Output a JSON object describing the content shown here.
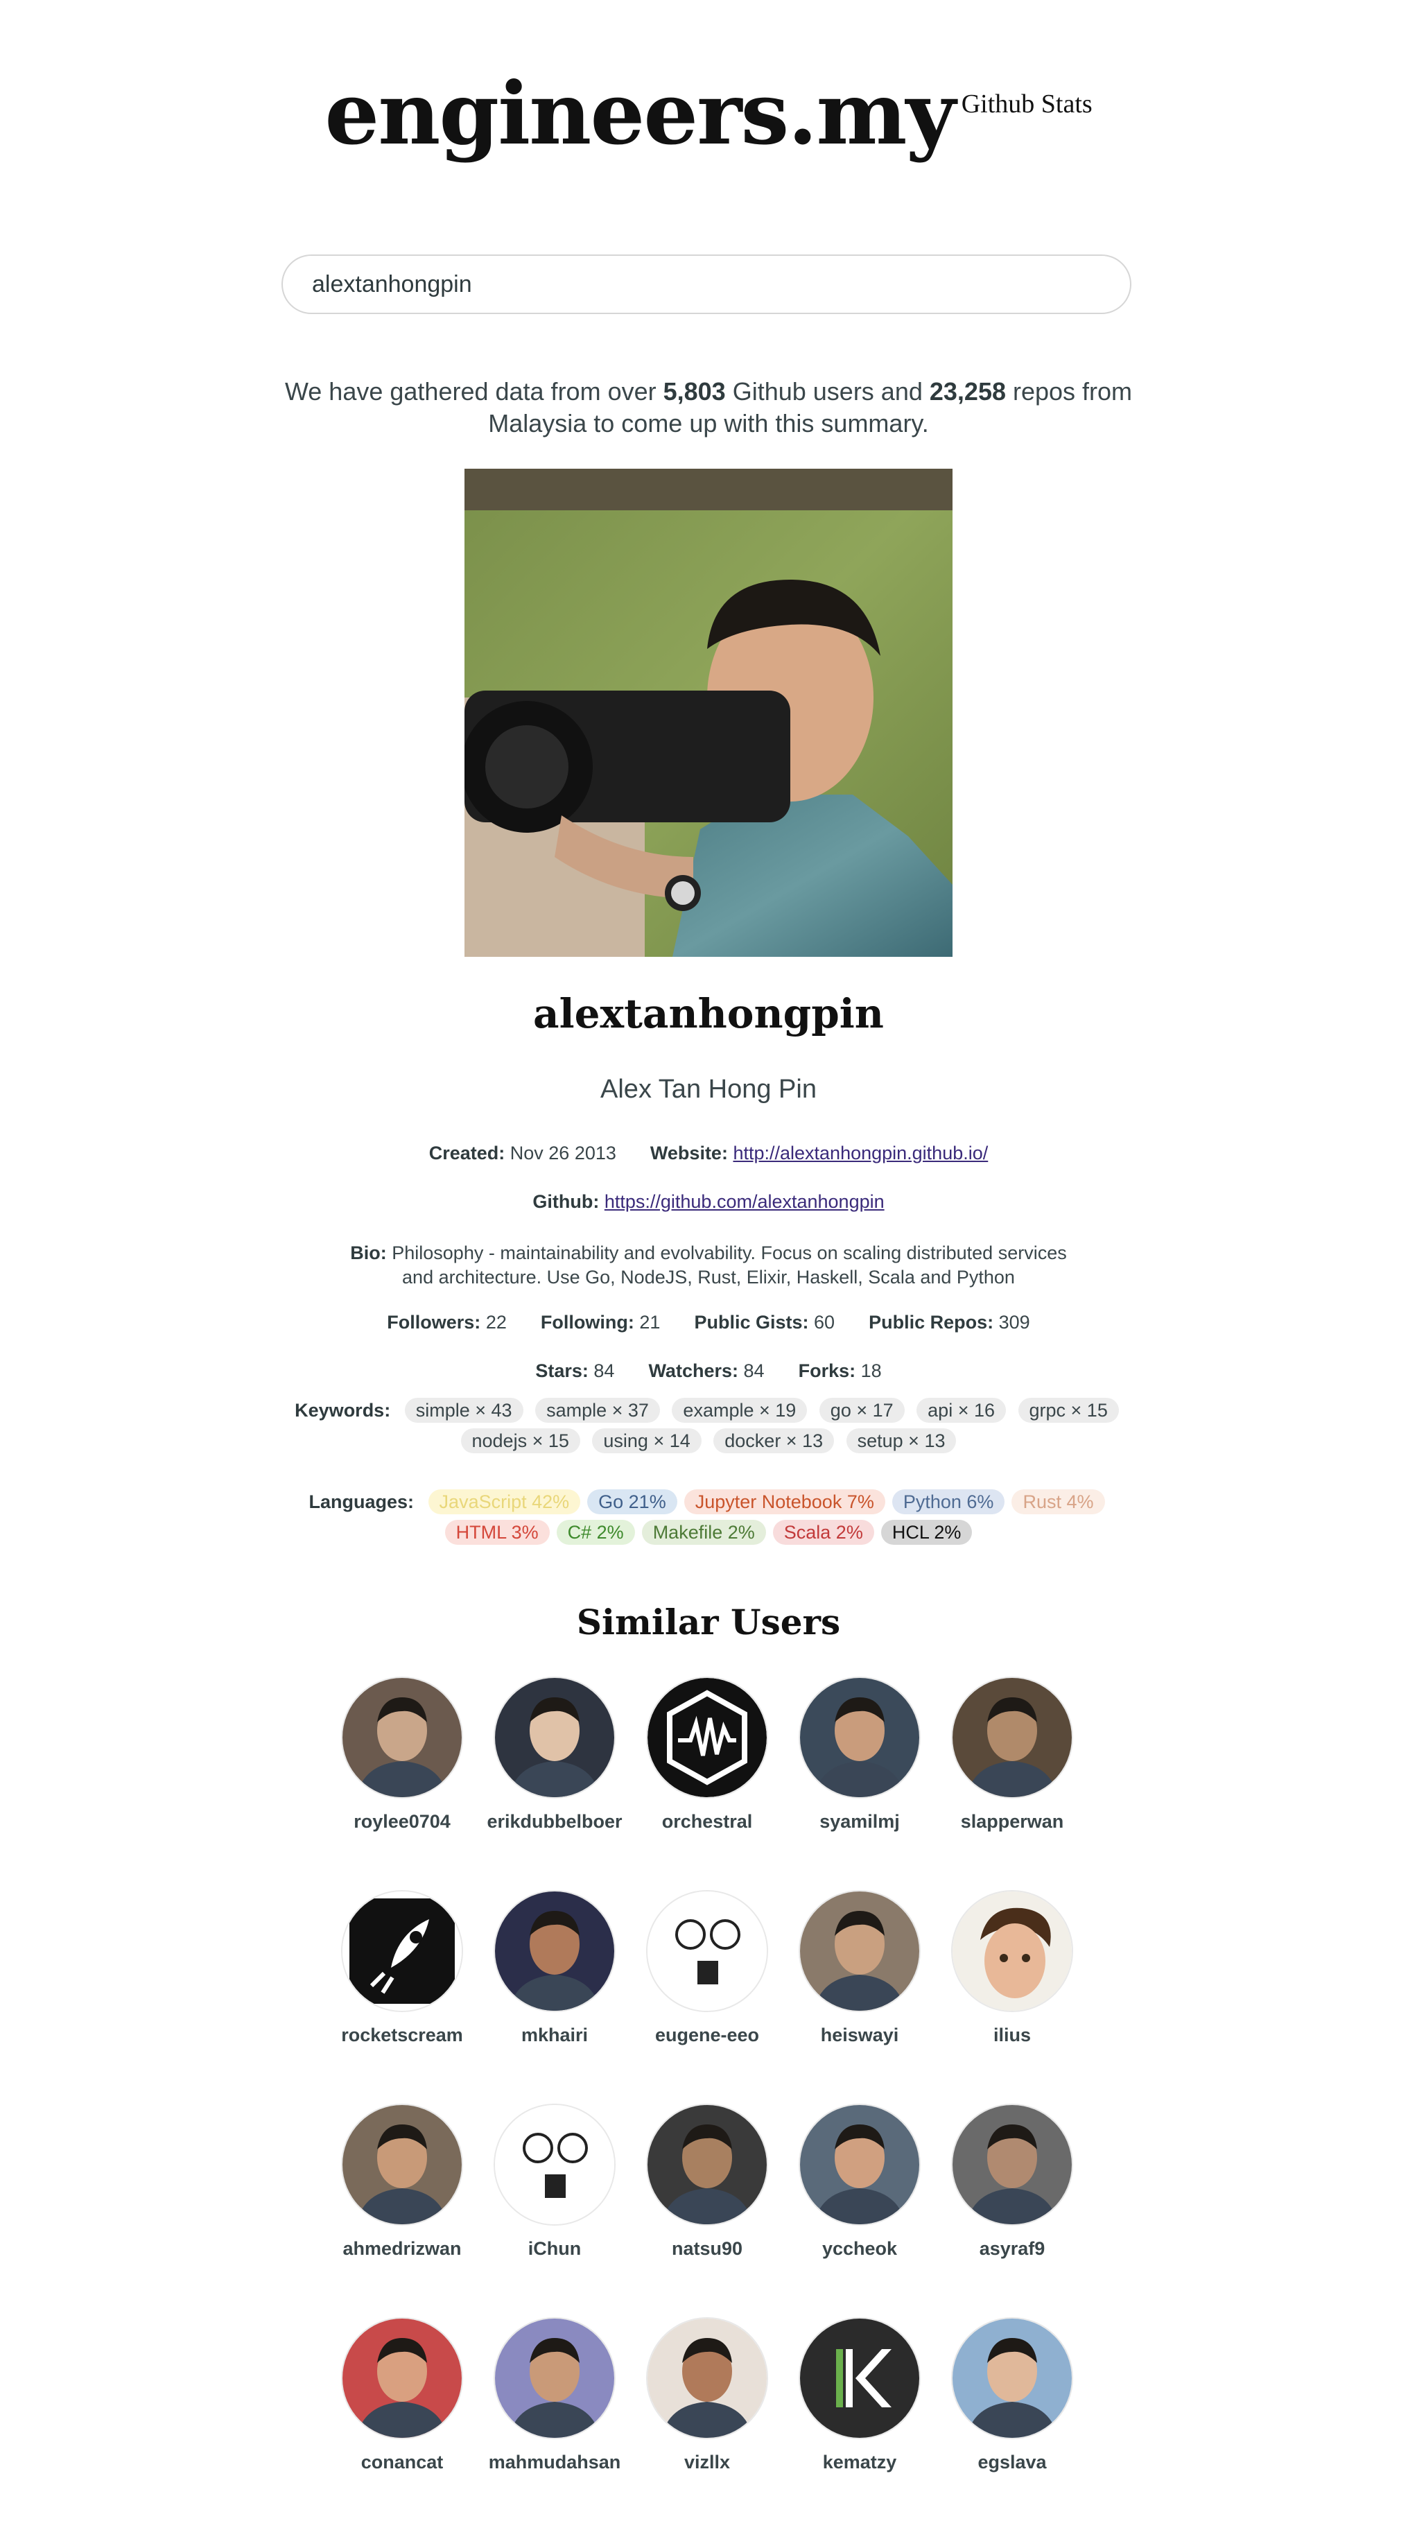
{
  "header": {
    "title": "engineers.my",
    "subtitle": "Github Stats"
  },
  "search": {
    "value": "alextanhongpin"
  },
  "summary": {
    "prefix": "We have gathered data from over ",
    "users_count": "5,803",
    "middle": " Github users and ",
    "repos_count": "23,258",
    "suffix": " repos from Malaysia to come up with this summary."
  },
  "profile": {
    "username": "alextanhongpin",
    "fullname": "Alex Tan Hong Pin",
    "created_label": "Created:",
    "created": "Nov 26 2013",
    "website_label": "Website:",
    "website": "http://alextanhongpin.github.io/",
    "github_label": "Github:",
    "github": "https://github.com/alextanhongpin",
    "bio_label": "Bio:",
    "bio": "Philosophy - maintainability and evolvability. Focus on scaling distributed services and architecture. Use Go, NodeJS, Rust, Elixir, Haskell, Scala and Python",
    "followers_label": "Followers:",
    "followers": "22",
    "following_label": "Following:",
    "following": "21",
    "gists_label": "Public Gists:",
    "gists": "60",
    "repos_label": "Public Repos:",
    "repos": "309",
    "stars_label": "Stars:",
    "stars": "84",
    "watchers_label": "Watchers:",
    "watchers": "84",
    "forks_label": "Forks:",
    "forks": "18"
  },
  "keywords": {
    "label": "Keywords:",
    "items": [
      "simple × 43",
      "sample × 37",
      "example × 19",
      "go × 17",
      "api × 16",
      "grpc × 15",
      "nodejs × 15",
      "using × 14",
      "docker × 13",
      "setup × 13"
    ]
  },
  "languages": {
    "label": "Languages:",
    "items": [
      {
        "text": "JavaScript 42%",
        "bg": "#fdf6d2",
        "fg": "#e9d77a"
      },
      {
        "text": "Go 21%",
        "bg": "#d9e6f3",
        "fg": "#3f5f8a"
      },
      {
        "text": "Jupyter Notebook 7%",
        "bg": "#fbe3dc",
        "fg": "#c9542b"
      },
      {
        "text": "Python 6%",
        "bg": "#dde5f2",
        "fg": "#4f6b93"
      },
      {
        "text": "Rust 4%",
        "bg": "#fbeee6",
        "fg": "#d8a488"
      },
      {
        "text": "HTML 3%",
        "bg": "#fbe0dc",
        "fg": "#d4473a"
      },
      {
        "text": "C# 2%",
        "bg": "#e3f2da",
        "fg": "#3e8a2c"
      },
      {
        "text": "Makefile 2%",
        "bg": "#e4eedb",
        "fg": "#4d7a36"
      },
      {
        "text": "Scala 2%",
        "bg": "#f8dcdc",
        "fg": "#c23a3a"
      },
      {
        "text": "HCL 2%",
        "bg": "#d6d6d6",
        "fg": "#111111"
      }
    ]
  },
  "similar": {
    "title": "Similar Users",
    "users": [
      {
        "name": "roylee0704",
        "avatar": "photo"
      },
      {
        "name": "erikdubbelboer",
        "avatar": "photo"
      },
      {
        "name": "orchestral",
        "avatar": "logo-wave"
      },
      {
        "name": "syamilmj",
        "avatar": "photo"
      },
      {
        "name": "slapperwan",
        "avatar": "photo"
      },
      {
        "name": "rocketscream",
        "avatar": "logo-rocket"
      },
      {
        "name": "mkhairi",
        "avatar": "photo"
      },
      {
        "name": "eugene-eeo",
        "avatar": "drawing"
      },
      {
        "name": "heiswayi",
        "avatar": "photo"
      },
      {
        "name": "ilius",
        "avatar": "cartoon"
      },
      {
        "name": "ahmedrizwan",
        "avatar": "photo"
      },
      {
        "name": "iChun",
        "avatar": "drawing"
      },
      {
        "name": "natsu90",
        "avatar": "photo"
      },
      {
        "name": "yccheok",
        "avatar": "photo"
      },
      {
        "name": "asyraf9",
        "avatar": "photo"
      },
      {
        "name": "conancat",
        "avatar": "photo"
      },
      {
        "name": "mahmudahsan",
        "avatar": "photo"
      },
      {
        "name": "vizllx",
        "avatar": "photo"
      },
      {
        "name": "kematzy",
        "avatar": "logo-k"
      },
      {
        "name": "egslava",
        "avatar": "photo"
      }
    ]
  }
}
